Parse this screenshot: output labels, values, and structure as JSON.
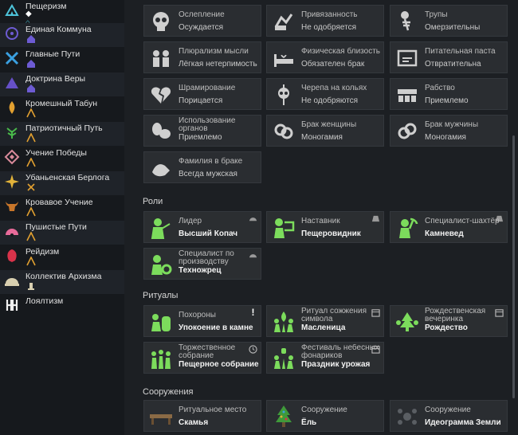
{
  "sidebar": {
    "items": [
      {
        "label": "Пещеризм",
        "icon": "cave-icon",
        "color": "#4dc3d9"
      },
      {
        "label": "Единая Коммуна",
        "icon": "commune-icon",
        "color": "#6d5bd3"
      },
      {
        "label": "Главные Пути",
        "icon": "cross-icon",
        "color": "#3aa0e0"
      },
      {
        "label": "Доктрина Веры",
        "icon": "triangle-icon",
        "color": "#6650c8"
      },
      {
        "label": "Кромешный Табун",
        "icon": "flame-icon",
        "color": "#e2a030"
      },
      {
        "label": "Патриотичный Путь",
        "icon": "plant-icon",
        "color": "#49b84a"
      },
      {
        "label": "Учение Победы",
        "icon": "diamond-icon",
        "color": "#d98a9a"
      },
      {
        "label": "Убаньенская Берлога",
        "icon": "star-icon",
        "color": "#e2b33a"
      },
      {
        "label": "Кровавое Учение",
        "icon": "bull-icon",
        "color": "#c8762a"
      },
      {
        "label": "Пушистые Пути",
        "icon": "fan-icon",
        "color": "#e86b9a"
      },
      {
        "label": "Рейдизм",
        "icon": "shield-icon",
        "color": "#d9334a"
      },
      {
        "label": "Коллектив Архизма",
        "icon": "dome-icon",
        "color": "#d8cfb0"
      },
      {
        "label": "Лоялтизм",
        "icon": "hh-icon",
        "color": "#f0f0f0"
      }
    ]
  },
  "precepts": [
    {
      "title": "Ослепление",
      "value": "Осуждается",
      "icon": "skull-icon"
    },
    {
      "title": "Привязанность",
      "value": "Не одобряется",
      "icon": "bond-icon"
    },
    {
      "title": "Трупы",
      "value": "Омерзительны",
      "icon": "skeleton-icon"
    },
    {
      "title": "Плюрализм мысли",
      "value": "Лёгкая нетерпимость",
      "icon": "minds-icon"
    },
    {
      "title": "Физическая близость",
      "value": "Обязателен брак",
      "icon": "bed-icon"
    },
    {
      "title": "Питательная паста",
      "value": "Отвратительна",
      "icon": "paste-icon"
    },
    {
      "title": "Шрамирование",
      "value": "Порицается",
      "icon": "broken-heart-icon"
    },
    {
      "title": "Черепа на кольях",
      "value": "Не одобряются",
      "icon": "skull-spike-icon"
    },
    {
      "title": "Рабство",
      "value": "Приемлемо",
      "icon": "slave-icon"
    },
    {
      "title": "Использование органов",
      "value": "Приемлемо",
      "icon": "organs-icon"
    },
    {
      "title": "Брак женщины",
      "value": "Моногамия",
      "icon": "ring-female-icon"
    },
    {
      "title": "Брак мужчины",
      "value": "Моногамия",
      "icon": "ring-male-icon"
    },
    {
      "title": "Фамилия в браке",
      "value": "Всегда мужская",
      "icon": "hands-icon"
    }
  ],
  "sections": {
    "roles": "Роли",
    "rituals": "Ритуалы",
    "buildings": "Сооружения"
  },
  "roles": [
    {
      "title": "Лидер",
      "value": "Высший Копач",
      "icon": "leader-icon"
    },
    {
      "title": "Наставник",
      "value": "Пещеровидник",
      "icon": "mentor-icon"
    },
    {
      "title": "Специалист-шахтёр",
      "value": "Камневед",
      "icon": "miner-icon"
    },
    {
      "title": "Специалист по производству",
      "value": "Техножрец",
      "icon": "gear-person-icon"
    }
  ],
  "rituals": [
    {
      "title": "Похороны",
      "value": "Упокоение в камне",
      "icon": "funeral-icon",
      "badge": "!"
    },
    {
      "title": "Ритуал сожжения символа",
      "value": "Масленица",
      "icon": "burn-icon",
      "badge": "calendar"
    },
    {
      "title": "Рождественская вечеринка",
      "value": "Рождество",
      "icon": "xmas-icon",
      "badge": "calendar"
    },
    {
      "title": "Торжественное собрание",
      "value": "Пещерное собрание",
      "icon": "gathering-icon",
      "badge": "clock"
    },
    {
      "title": "Фестиваль небесных фонариков",
      "value": "Праздник урожая",
      "icon": "lantern-icon",
      "badge": "calendar"
    }
  ],
  "buildings": [
    {
      "title": "Ритуальное место",
      "value": "Скамья",
      "icon": "bench-icon"
    },
    {
      "title": "Сооружение",
      "value": "Ёль",
      "icon": "tree-icon"
    },
    {
      "title": "Сооружение",
      "value": "Идеограмма Земли",
      "icon": "ideogram-icon"
    }
  ]
}
